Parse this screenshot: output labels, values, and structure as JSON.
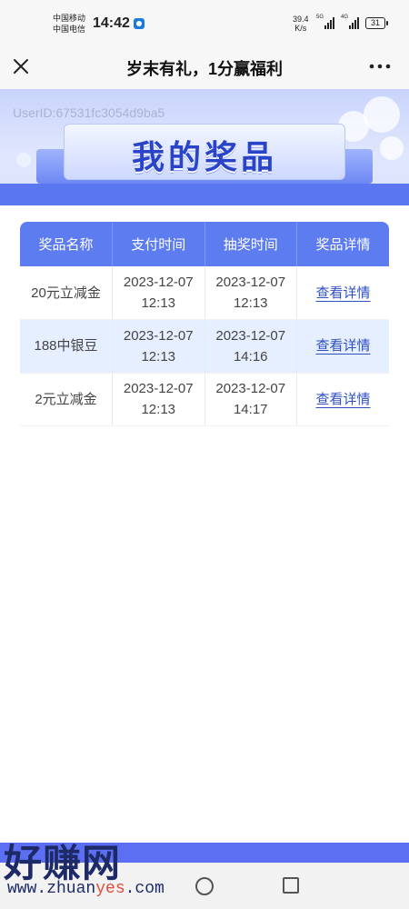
{
  "status_bar": {
    "carrier_1": "中国移动",
    "carrier_2": "中国电信",
    "time": "14:42",
    "speed_value": "39.4",
    "speed_unit": "K/s",
    "sig1_label": "5G",
    "sig2_label": "4G",
    "battery": "31"
  },
  "nav": {
    "title": "岁末有礼，1分赢福利"
  },
  "banner": {
    "user_id": "UserID:67531fc3054d9ba5",
    "title": "我的奖品"
  },
  "table": {
    "headers": [
      "奖品名称",
      "支付时间",
      "抽奖时间",
      "奖品详情"
    ],
    "rows": [
      {
        "name": "20元立减金",
        "pay_date": "2023-12-07",
        "pay_time": "12:13",
        "draw_date": "2023-12-07",
        "draw_time": "12:13",
        "detail": "查看详情"
      },
      {
        "name": "188中银豆",
        "pay_date": "2023-12-07",
        "pay_time": "12:13",
        "draw_date": "2023-12-07",
        "draw_time": "14:16",
        "detail": "查看详情"
      },
      {
        "name": "2元立减金",
        "pay_date": "2023-12-07",
        "pay_time": "12:13",
        "draw_date": "2023-12-07",
        "draw_time": "14:17",
        "detail": "查看详情"
      }
    ]
  },
  "watermark": {
    "main": "好赚网",
    "url_pre": "www.zhuan",
    "url_hl": "yes",
    "url_post": ".com"
  },
  "colors": {
    "accent": "#5c7cf0",
    "link": "#2e4fc4",
    "alt_row": "#e6efff"
  }
}
